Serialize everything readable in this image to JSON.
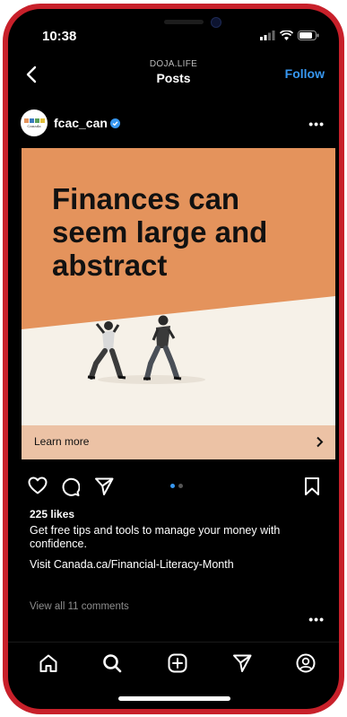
{
  "status_bar": {
    "time": "10:38"
  },
  "header": {
    "account": "DOJA.LIFE",
    "title": "Posts",
    "follow_label": "Follow"
  },
  "post_author": {
    "username": "fcac_can"
  },
  "post": {
    "headline": "Finances can seem large and abstract",
    "cta_label": "Learn more",
    "carousel_count": 2,
    "carousel_active": 1
  },
  "engagement": {
    "likes": "225 likes",
    "caption": "Get free tips and tools to manage your money with confidence.",
    "link_text": "Visit Canada.ca/Financial-Literacy-Month",
    "comments_link": "View all 11 comments"
  },
  "colors": {
    "frame": "#c8202a",
    "accent": "#3797f0",
    "post_orange": "#e4935c",
    "post_cream": "#f6f1e8",
    "cta_bg": "#ecc2a5"
  },
  "icons": [
    "back-icon",
    "more-icon",
    "heart-icon",
    "comment-icon",
    "share-icon",
    "bookmark-icon",
    "home-icon",
    "search-icon",
    "create-icon",
    "direct-icon",
    "profile-icon",
    "verified-icon"
  ]
}
